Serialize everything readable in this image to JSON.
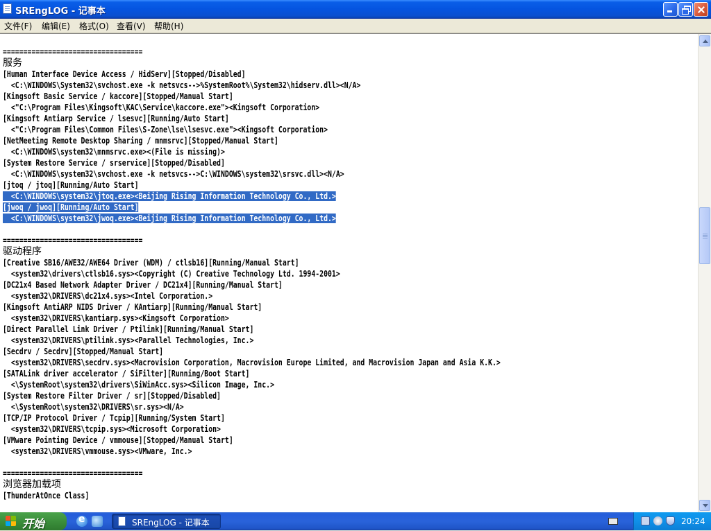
{
  "window": {
    "title": "SREngLOG - 记事本"
  },
  "menu": [
    "文件(F)",
    "编辑(E)",
    "格式(O)",
    "查看(V)",
    "帮助(H)"
  ],
  "content_lines": [
    {
      "text": "==================================",
      "cjk": false,
      "sel": "none"
    },
    {
      "text": "服务",
      "cjk": true,
      "sel": "none"
    },
    {
      "text": "[Human Interface Device Access / HidServ][Stopped/Disabled]",
      "cjk": false,
      "sel": "none"
    },
    {
      "text": "  <C:\\WINDOWS\\System32\\svchost.exe -k netsvcs-->%SystemRoot%\\System32\\hidserv.dll><N/A>",
      "cjk": false,
      "sel": "none"
    },
    {
      "text": "[Kingsoft Basic Service / kaccore][Stopped/Manual Start]",
      "cjk": false,
      "sel": "none"
    },
    {
      "text": "  <\"C:\\Program Files\\Kingsoft\\KAC\\Service\\kaccore.exe\"><Kingsoft Corporation>",
      "cjk": false,
      "sel": "none"
    },
    {
      "text": "[Kingsoft Antiarp Service / lsesvc][Running/Auto Start]",
      "cjk": false,
      "sel": "none"
    },
    {
      "text": "  <\"C:\\Program Files\\Common Files\\S-Zone\\lse\\lsesvc.exe\"><Kingsoft Corporation>",
      "cjk": false,
      "sel": "none"
    },
    {
      "text": "[NetMeeting Remote Desktop Sharing / mnmsrvc][Stopped/Manual Start]",
      "cjk": false,
      "sel": "none"
    },
    {
      "text": "  <C:\\WINDOWS\\system32\\mnmsrvc.exe><(File is missing)>",
      "cjk": false,
      "sel": "none"
    },
    {
      "text": "[System Restore Service / srservice][Stopped/Disabled]",
      "cjk": false,
      "sel": "none"
    },
    {
      "text": "  <C:\\WINDOWS\\system32\\svchost.exe -k netsvcs-->C:\\WINDOWS\\system32\\srsvc.dll><N/A>",
      "cjk": false,
      "sel": "none"
    },
    {
      "text": "[jtoq / jtoq][Running/Auto Start]",
      "cjk": false,
      "sel": "none"
    },
    {
      "text": "  <C:\\WINDOWS\\system32\\jtoq.exe><Beijing Rising Information Technology Co., Ltd.>",
      "cjk": false,
      "sel": "full"
    },
    {
      "text": "[jwoq / jwoq][Running/Auto Start]",
      "cjk": false,
      "sel": "full"
    },
    {
      "text": "  <C:\\WINDOWS\\system32\\jwoq.exe><Beijing Rising Information Technology Co., Ltd.>",
      "cjk": false,
      "sel": "full"
    },
    {
      "text": "",
      "cjk": false,
      "sel": "none"
    },
    {
      "text": "==================================",
      "cjk": false,
      "sel": "none"
    },
    {
      "text": "驱动程序",
      "cjk": true,
      "sel": "none"
    },
    {
      "text": "[Creative SB16/AWE32/AWE64 Driver (WDM) / ctlsb16][Running/Manual Start]",
      "cjk": false,
      "sel": "none"
    },
    {
      "text": "  <system32\\drivers\\ctlsb16.sys><Copyright (C) Creative Technology Ltd. 1994-2001>",
      "cjk": false,
      "sel": "none"
    },
    {
      "text": "[DC21x4 Based Network Adapter Driver / DC21x4][Running/Manual Start]",
      "cjk": false,
      "sel": "none"
    },
    {
      "text": "  <system32\\DRIVERS\\dc21x4.sys><Intel Corporation.>",
      "cjk": false,
      "sel": "none"
    },
    {
      "text": "[Kingsoft AntiARP NIDS Driver / KAntiarp][Running/Manual Start]",
      "cjk": false,
      "sel": "none"
    },
    {
      "text": "  <system32\\DRIVERS\\kantiarp.sys><Kingsoft Corporation>",
      "cjk": false,
      "sel": "none"
    },
    {
      "text": "[Direct Parallel Link Driver / Ptilink][Running/Manual Start]",
      "cjk": false,
      "sel": "none"
    },
    {
      "text": "  <system32\\DRIVERS\\ptilink.sys><Parallel Technologies, Inc.>",
      "cjk": false,
      "sel": "none"
    },
    {
      "text": "[Secdrv / Secdrv][Stopped/Manual Start]",
      "cjk": false,
      "sel": "none"
    },
    {
      "text": "  <system32\\DRIVERS\\secdrv.sys><Macrovision Corporation, Macrovision Europe Limited, and Macrovision Japan and Asia K.K.>",
      "cjk": false,
      "sel": "none"
    },
    {
      "text": "[SATALink driver accelerator / SiFilter][Running/Boot Start]",
      "cjk": false,
      "sel": "none"
    },
    {
      "text": "  <\\SystemRoot\\system32\\drivers\\SiWinAcc.sys><Silicon Image, Inc.>",
      "cjk": false,
      "sel": "none"
    },
    {
      "text": "[System Restore Filter Driver / sr][Stopped/Disabled]",
      "cjk": false,
      "sel": "none"
    },
    {
      "text": "  <\\SystemRoot\\system32\\DRIVERS\\sr.sys><N/A>",
      "cjk": false,
      "sel": "none"
    },
    {
      "text": "[TCP/IP Protocol Driver / Tcpip][Running/System Start]",
      "cjk": false,
      "sel": "none"
    },
    {
      "text": "  <system32\\DRIVERS\\tcpip.sys><Microsoft Corporation>",
      "cjk": false,
      "sel": "none"
    },
    {
      "text": "[VMware Pointing Device / vmmouse][Stopped/Manual Start]",
      "cjk": false,
      "sel": "none"
    },
    {
      "text": "  <system32\\DRIVERS\\vmmouse.sys><VMware, Inc.>",
      "cjk": false,
      "sel": "none"
    },
    {
      "text": "",
      "cjk": false,
      "sel": "none"
    },
    {
      "text": "==================================",
      "cjk": false,
      "sel": "none"
    },
    {
      "text": "浏览器加载项",
      "cjk": true,
      "sel": "none"
    },
    {
      "text": "[ThunderAtOnce Class]",
      "cjk": false,
      "sel": "none"
    }
  ],
  "taskbar": {
    "start_label": "开始",
    "task_label": "SREngLOG - 记事本",
    "clock": "20:24"
  },
  "colors": {
    "selection": "#316AC5",
    "titlebar": "#0554E0",
    "start": "#3C8F3C"
  }
}
